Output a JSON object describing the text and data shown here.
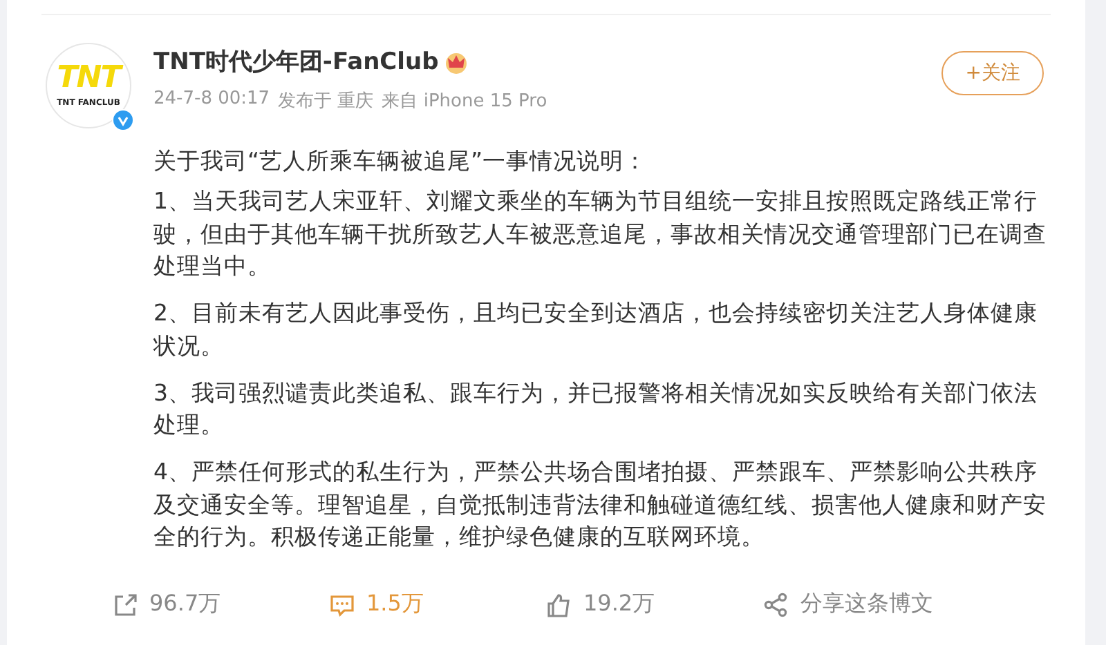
{
  "post": {
    "avatar": {
      "logo": "TNT",
      "caption": "TNT FANCLUB",
      "verified": true
    },
    "author": "TNT时代少年团-FanClub",
    "follow_button": "+关注",
    "meta": [
      "24-7-8 00:17",
      "发布于 重庆",
      "来自 iPhone 15 Pro"
    ],
    "paragraphs": [
      "关于我司“艺人所乘车辆被追尾”一事情况说明：",
      "1、当天我司艺人宋亚轩、刘耀文乘坐的车辆为节目组统一安排且按照既定路线正常行驶，但由于其他车辆干扰所致艺人车被恶意追尾，事故相关情况交通管理部门已在调查处理当中。",
      "2、目前未有艺人因此事受伤，且均已安全到达酒店，也会持续密切关注艺人身体健康状况。",
      "3、我司强烈谴责此类追私、跟车行为，并已报警将相关情况如实反映给有关部门依法处理。",
      "4、严禁任何形式的私生行为，严禁公共场合围堵拍摄、严禁跟车、严禁影响公共秩序及交通安全等。理智追星，自觉抵制违背法律和触碰道德红线、损害他人健康和财产安全的行为。积极传递正能量，维护绿色健康的互联网环境。"
    ]
  },
  "actions": [
    {
      "kind": "repost",
      "count": "96.7万",
      "selected": false
    },
    {
      "kind": "comment",
      "count": "1.5万",
      "selected": true
    },
    {
      "kind": "like",
      "count": "19.2万",
      "selected": false
    },
    {
      "kind": "share",
      "count": "分享这条博文",
      "selected": false
    }
  ]
}
